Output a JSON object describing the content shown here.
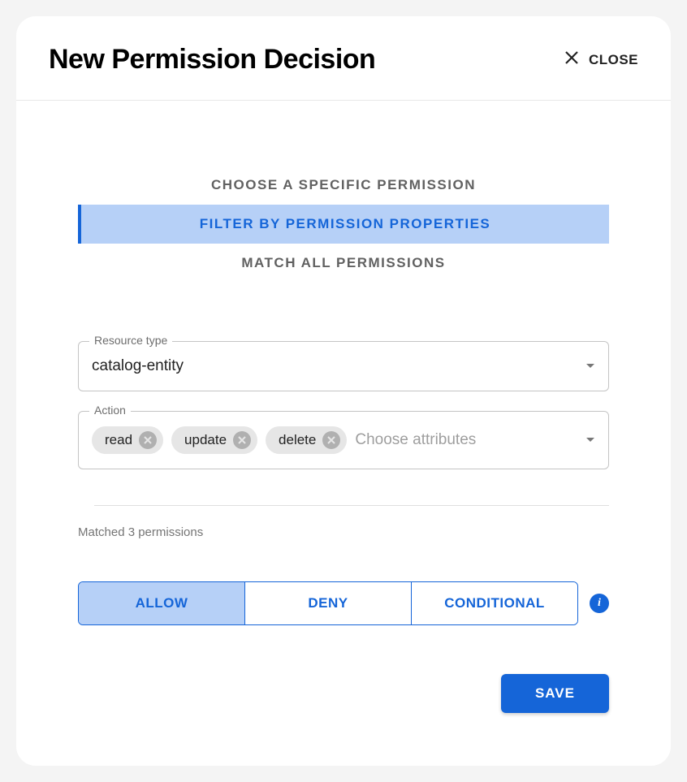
{
  "header": {
    "title": "New Permission Decision",
    "close_label": "CLOSE"
  },
  "tabs": [
    {
      "label": "CHOOSE A SPECIFIC PERMISSION",
      "active": false
    },
    {
      "label": "FILTER BY PERMISSION PROPERTIES",
      "active": true
    },
    {
      "label": "MATCH ALL PERMISSIONS",
      "active": false
    }
  ],
  "resource_field": {
    "label": "Resource type",
    "value": "catalog-entity"
  },
  "action_field": {
    "label": "Action",
    "chips": [
      "read",
      "update",
      "delete"
    ],
    "placeholder": "Choose attributes"
  },
  "match_text": "Matched 3 permissions",
  "decisions": [
    {
      "label": "ALLOW",
      "selected": true
    },
    {
      "label": "DENY",
      "selected": false
    },
    {
      "label": "CONDITIONAL",
      "selected": false
    }
  ],
  "save_label": "SAVE"
}
